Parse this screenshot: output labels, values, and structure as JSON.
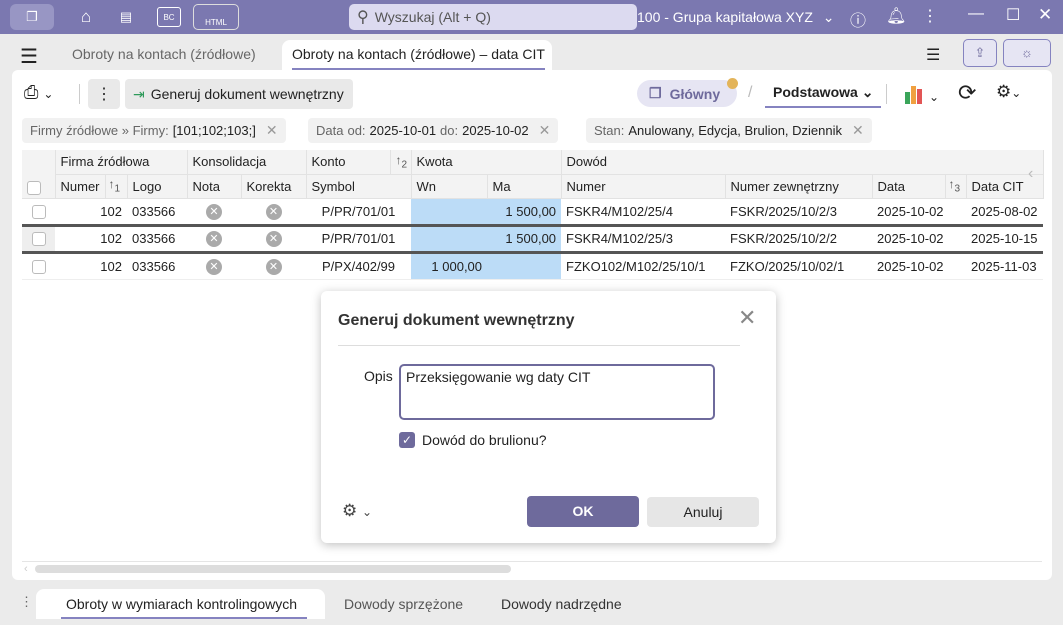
{
  "titlebar": {
    "search_placeholder": "Wyszukaj (Alt + Q)",
    "company": "100 - Grupa kapitałowa XYZ",
    "icons": [
      "app-logo-icon",
      "home-icon",
      "newspaper-icon",
      "bc-icon",
      "html-icon"
    ]
  },
  "tabs": [
    {
      "label": "Obroty na kontach (źródłowe)"
    },
    {
      "label": "Obroty na kontach (źródłowe) – data CIT"
    }
  ],
  "toolbar": {
    "generate_label": "Generuj dokument wewnętrzny",
    "view_label": "Główny",
    "layout_label": "Podstawowa",
    "separator": "/"
  },
  "filters": [
    {
      "prefix": "Firmy źródłowe » Firmy:",
      "value": "[101;102;103;]"
    },
    {
      "prefix": "Data",
      "from_label": "od:",
      "from": "2025-10-01",
      "to_label": "do:",
      "to": "2025-10-02"
    },
    {
      "prefix": "Stan:",
      "value": "Anulowany, Edycja, Brulion, Dziennik"
    }
  ],
  "table": {
    "groups": {
      "firma": "Firma źródłowa",
      "konsolidacja": "Konsolidacja",
      "konto": "Konto",
      "kwota": "Kwota",
      "dowod": "Dowód"
    },
    "columns": {
      "numer": "Numer",
      "logo": "Logo",
      "nota": "Nota",
      "korekta": "Korekta",
      "symbol": "Symbol",
      "wn": "Wn",
      "ma": "Ma",
      "dnumer": "Numer",
      "zewn": "Numer zewnętrzny",
      "data": "Data",
      "datacit": "Data CIT"
    },
    "sort": {
      "s1": "1",
      "s2": "2",
      "s3": "3"
    },
    "rows": [
      {
        "numer": "102",
        "logo": "033566",
        "symbol": "P/PR/701/01",
        "wn": "",
        "ma": "1 500,00",
        "dnumer": "FSKR4/M102/25/4",
        "zewn": "FSKR/2025/10/2/3",
        "data": "2025-10-02",
        "datacit": "2025-08-02"
      },
      {
        "numer": "102",
        "logo": "033566",
        "symbol": "P/PR/701/01",
        "wn": "",
        "ma": "1 500,00",
        "dnumer": "FSKR4/M102/25/3",
        "zewn": "FSKR/2025/10/2/2",
        "data": "2025-10-02",
        "datacit": "2025-10-15"
      },
      {
        "numer": "102",
        "logo": "033566",
        "symbol": "P/PX/402/99",
        "wn": "1 000,00",
        "ma": "",
        "dnumer": "FZKO102/M102/25/10/1",
        "zewn": "FZKO/2025/10/02/1",
        "data": "2025-10-02",
        "datacit": "2025-11-03"
      }
    ]
  },
  "dialog": {
    "title": "Generuj dokument wewnętrzny",
    "opis_label": "Opis",
    "opis_value": "Przeksięgowanie wg daty CIT",
    "checkbox_label": "Dowód do brulionu?",
    "checkbox_checked": true,
    "ok": "OK",
    "cancel": "Anuluj"
  },
  "bottom_tabs": [
    {
      "label": "Obroty w wymiarach kontrolingowych"
    },
    {
      "label": "Dowody sprzężone"
    },
    {
      "label": "Dowody nadrzędne"
    }
  ],
  "colors": {
    "accent": "#7b78b0",
    "highlight": "#bcdcf7",
    "ok_button": "#6e6a9c"
  }
}
